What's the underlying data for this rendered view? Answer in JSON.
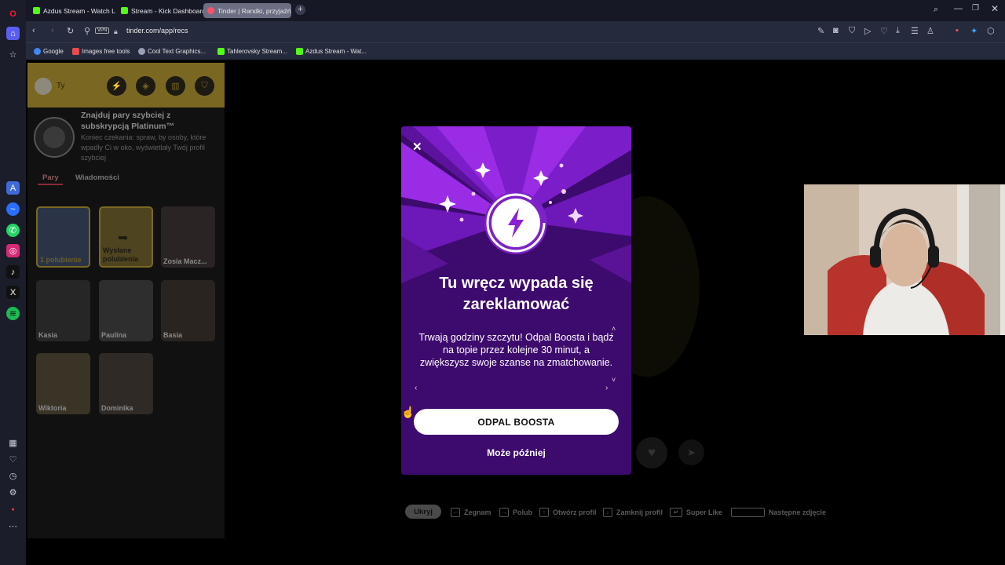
{
  "browser": {
    "tabs": [
      {
        "label": "Azdus Stream - Watch Liv",
        "color": "#53fc18"
      },
      {
        "label": "Stream - Kick Dashboard",
        "color": "#53fc18"
      },
      {
        "label": "Tinder | Randki, przyjaźń",
        "color": "#fd5068",
        "active": true
      }
    ],
    "url": "tinder.com/app/recs",
    "vpn_label": "VPN",
    "bookmarks": [
      {
        "label": "Google",
        "color": "#4285f4"
      },
      {
        "label": "Images free tools",
        "color": "#e94b4b"
      },
      {
        "label": "Cool Text Graphics...",
        "color": "#9aa0b5"
      },
      {
        "label": "Tahlerovsky Stream...",
        "color": "#53fc18"
      },
      {
        "label": "Azdus Stream - Wat...",
        "color": "#53fc18"
      }
    ]
  },
  "tinder": {
    "user_label": "Ty",
    "platinum": {
      "title": "Znajduj pary szybciej z subskrypcją Platinum™",
      "desc": "Koniec czekania: spraw, by osoby, które wpadły Ci w oko, wyświetlały Twój profil szybciej"
    },
    "tabs": [
      "Pary",
      "Wiadomości"
    ],
    "matches": [
      {
        "name": "1 polubienie",
        "special": true
      },
      {
        "name": "Wysłane polubienia",
        "special": true
      },
      {
        "name": "Zosia Macz..."
      },
      {
        "name": "Kasia"
      },
      {
        "name": "Paulina"
      },
      {
        "name": "Basia"
      },
      {
        "name": "Wiktoria"
      },
      {
        "name": "Dominika"
      }
    ]
  },
  "modal": {
    "title": "Tu wręcz wypada się zareklamować",
    "body": "Trwają godziny szczytu! Odpal Boosta i bądź na topie przez kolejne 30 minut, a zwiększysz swoje szanse na zmatchowanie.",
    "primary_button": "ODPAL BOOSTA",
    "secondary_button": "Może później",
    "accent": "#8a1fd6"
  },
  "hints": {
    "hide": "Ukryj",
    "items": [
      "Żegnam",
      "Polub",
      "Otwórz profil",
      "Zamknij profil",
      "Super Like",
      "Następne zdjęcie"
    ]
  }
}
